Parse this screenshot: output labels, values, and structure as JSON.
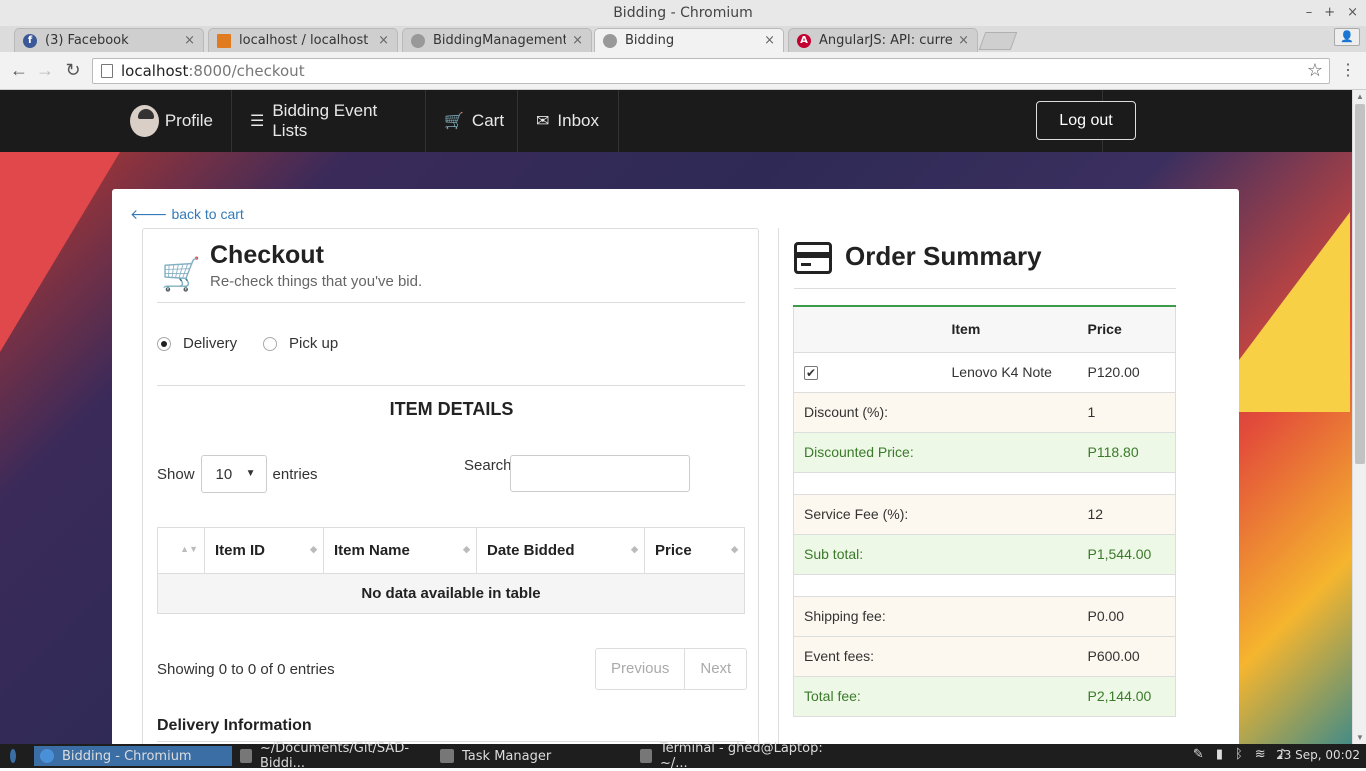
{
  "window": {
    "title": "Bidding - Chromium"
  },
  "tabs": [
    {
      "label": "(3) Facebook",
      "icon": "facebook-icon"
    },
    {
      "label": "localhost / localhost / sa",
      "icon": "phpmyadmin-icon"
    },
    {
      "label": "BiddingManagementSy",
      "icon": "globe-icon"
    },
    {
      "label": "Bidding",
      "icon": "globe-icon"
    },
    {
      "label": "AngularJS: API: currency",
      "icon": "angular-icon"
    }
  ],
  "address": {
    "host": "localhost",
    "rest": ":8000/checkout"
  },
  "nav": {
    "profile": "Profile",
    "events": "Bidding Event Lists",
    "cart": "Cart",
    "inbox": "Inbox",
    "logout": "Log out"
  },
  "checkout": {
    "back": "back to cart",
    "title": "Checkout",
    "subtitle": "Re-check things that you've bid.",
    "radio_delivery": "Delivery",
    "radio_pickup": "Pick up",
    "item_details": "ITEM DETAILS",
    "show": "Show",
    "entries_value": "10",
    "entries": "entries",
    "search": "Search:",
    "columns": [
      "Item ID",
      "Item Name",
      "Date Bidded",
      "Price"
    ],
    "empty": "No data available in table",
    "showing": "Showing 0 to 0 of 0 entries",
    "previous": "Previous",
    "next": "Next",
    "delivery_info": "Delivery Information"
  },
  "summary": {
    "title": "Order Summary",
    "col_item": "Item",
    "col_price": "Price",
    "item_name": "Lenovo K4 Note",
    "item_price": "P120.00",
    "discount_label": "Discount (%):",
    "discount_value": "1",
    "discounted_label": "Discounted Price:",
    "discounted_value": "P118.80",
    "service_label": "Service Fee (%):",
    "service_value": "12",
    "subtotal_label": "Sub total:",
    "subtotal_value": "P1,544.00",
    "shipping_label": "Shipping fee:",
    "shipping_value": "P0.00",
    "event_label": "Event fees:",
    "event_value": "P600.00",
    "total_label": "Total fee:",
    "total_value": "P2,144.00"
  },
  "taskbar": {
    "items": [
      "Bidding - Chromium",
      "~/Documents/Git/SAD-Biddi...",
      "Task Manager",
      "Terminal - ghed@Laptop: ~/..."
    ],
    "clock": "23 Sep, 00:02"
  }
}
